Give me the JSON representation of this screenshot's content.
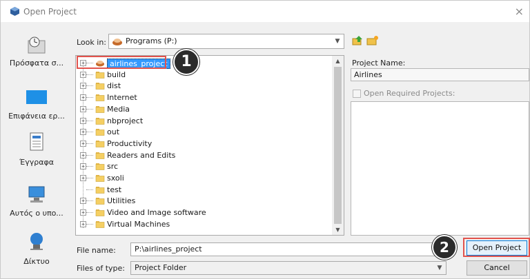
{
  "window": {
    "title": "Open Project",
    "close_glyph": "×"
  },
  "places": [
    {
      "label": "Πρόσφατα σ...",
      "icon": "recent-clock-icon"
    },
    {
      "label": "Επιφάνεια ερ...",
      "icon": "desktop-icon"
    },
    {
      "label": "Έγγραφα",
      "icon": "documents-icon"
    },
    {
      "label": "Αυτός ο υπο...",
      "icon": "this-pc-icon"
    },
    {
      "label": "Δίκτυο",
      "icon": "network-icon"
    }
  ],
  "look_in": {
    "label": "Look in:",
    "value": "Programs (P:)"
  },
  "tree": {
    "items": [
      {
        "label": "airlines_project",
        "expandable": true,
        "selected": true,
        "project": true
      },
      {
        "label": "build",
        "expandable": true
      },
      {
        "label": "dist",
        "expandable": true
      },
      {
        "label": "Internet",
        "expandable": true
      },
      {
        "label": "Media",
        "expandable": true
      },
      {
        "label": "nbproject",
        "expandable": true
      },
      {
        "label": "out",
        "expandable": true
      },
      {
        "label": "Productivity",
        "expandable": true
      },
      {
        "label": "Readers and Edits",
        "expandable": true
      },
      {
        "label": "src",
        "expandable": true
      },
      {
        "label": "sxoli",
        "expandable": true
      },
      {
        "label": "test",
        "expandable": false
      },
      {
        "label": "Utilities",
        "expandable": true
      },
      {
        "label": "Video and Image software",
        "expandable": true
      },
      {
        "label": "Virtual Machines",
        "expandable": true
      }
    ]
  },
  "project": {
    "name_label": "Project Name:",
    "name_value": "Airlines",
    "required_label": "Open Required Projects:"
  },
  "file_name": {
    "label": "File name:",
    "value": "P:\\airlines_project"
  },
  "file_type": {
    "label": "Files of type:",
    "value": "Project Folder"
  },
  "buttons": {
    "open": "Open Project",
    "cancel": "Cancel"
  },
  "callouts": {
    "one": "1",
    "two": "2"
  },
  "colors": {
    "selection": "#3399ff",
    "highlight": "#e2534d",
    "primary_border": "#0078d7"
  }
}
